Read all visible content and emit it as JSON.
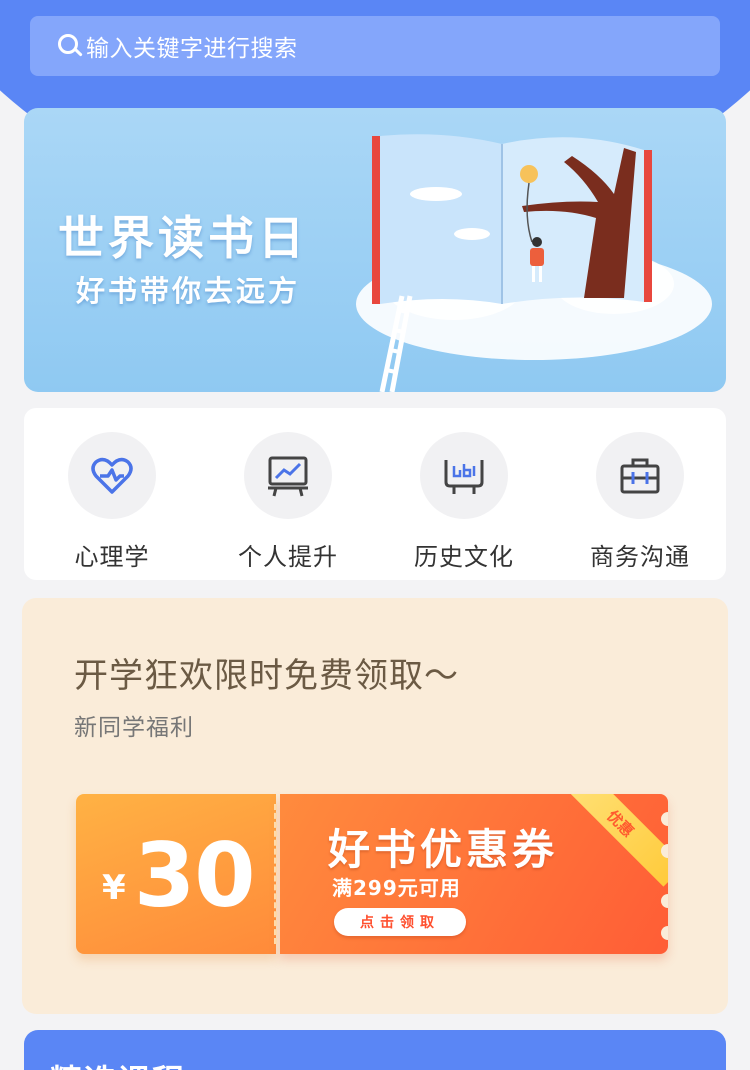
{
  "search": {
    "placeholder": "输入关键字进行搜索"
  },
  "banner": {
    "title": "世界读书日",
    "subtitle": "好书带你去远方"
  },
  "categories": [
    {
      "label": "心理学",
      "icon": "heart-pulse-icon"
    },
    {
      "label": "个人提升",
      "icon": "chart-board-icon"
    },
    {
      "label": "历史文化",
      "icon": "history-icon"
    },
    {
      "label": "商务沟通",
      "icon": "briefcase-icon"
    }
  ],
  "promo": {
    "title": "开学狂欢限时免费领取～",
    "subtitle": "新同学福利",
    "coupon": {
      "currency": "¥",
      "amount": "30",
      "name": "好书优惠券",
      "condition": "满299元可用",
      "button": "点击领取",
      "ribbon": "优惠"
    }
  },
  "featured": {
    "title": "精选课程"
  },
  "colors": {
    "brand_blue": "#5a86f5",
    "icon_blue": "#4b74e8",
    "coupon_orange": "#ff8b3d"
  }
}
